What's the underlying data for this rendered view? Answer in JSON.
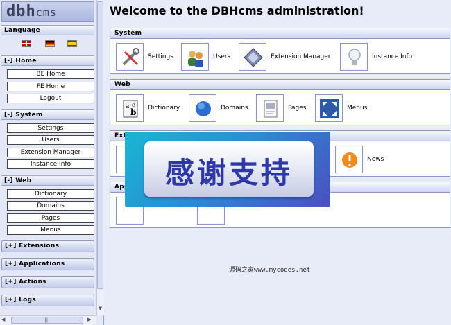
{
  "logo": {
    "main": "dbh",
    "sub": "cms"
  },
  "sidebar": {
    "language_heading": "Language",
    "home": {
      "heading": "[-] Home",
      "items": [
        "BE Home",
        "FE Home",
        "Logout"
      ]
    },
    "system": {
      "heading": "[-] System",
      "items": [
        "Settings",
        "Users",
        "Extension Manager",
        "Instance Info"
      ]
    },
    "web": {
      "heading": "[-] Web",
      "items": [
        "Dictionary",
        "Domains",
        "Pages",
        "Menus"
      ]
    },
    "extensions_heading": "[+] Extensions",
    "applications_heading": "[+] Applications",
    "actions_heading": "[+] Actions",
    "logs_heading": "[+] Logs"
  },
  "main": {
    "title": "Welcome to the DBHcms administration!",
    "system": {
      "heading": "System",
      "items": [
        "Settings",
        "Users",
        "Extension Manager",
        "Instance Info"
      ]
    },
    "web": {
      "heading": "Web",
      "items": [
        "Dictionary",
        "Domains",
        "Pages",
        "Menus"
      ]
    },
    "extensions": {
      "heading": "Ext",
      "news": "News"
    },
    "applications": {
      "heading": "App"
    }
  },
  "banner": {
    "text": "感谢支持"
  },
  "watermark": "源码之家www.mycodes.net",
  "scroll": {
    "hthumb": "|||",
    "vdown": "▼",
    "left": "◀",
    "right": "▶"
  },
  "colors": {
    "panel_border": "#8a97c4",
    "header_bg": "#cdd5ee",
    "banner_from": "#18b6d2",
    "banner_to": "#4b4fbf",
    "banner_text": "#2e37a8"
  }
}
